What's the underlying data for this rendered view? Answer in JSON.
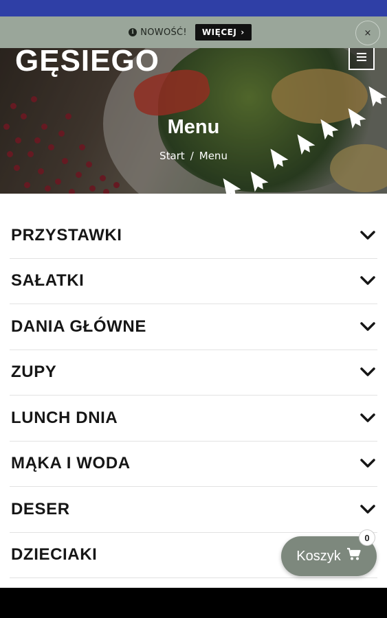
{
  "notice": {
    "text": "NOWOŚĆ!",
    "more_label": "WIĘCEJ",
    "more_arrow": "›",
    "close": "×",
    "info_glyph": "i"
  },
  "header": {
    "logo_text": "GĘSIEGO",
    "page_title": "Menu",
    "breadcrumb": {
      "home": "Start",
      "separator": "/",
      "current": "Menu"
    }
  },
  "menu": {
    "items": [
      {
        "label": "PRZYSTAWKI"
      },
      {
        "label": "SAŁATKI"
      },
      {
        "label": "DANIA GŁÓWNE"
      },
      {
        "label": "ZUPY"
      },
      {
        "label": "LUNCH DNIA"
      },
      {
        "label": "MĄKA I WODA"
      },
      {
        "label": "DESER"
      },
      {
        "label": "DZIECIAKI"
      }
    ]
  },
  "cart": {
    "label": "Koszyk",
    "count": "0"
  },
  "colors": {
    "status_strip": "#2f3fa6",
    "notice_bar": "#9aa69a",
    "cart_button": "#7d887d",
    "menu_text": "#161616"
  }
}
